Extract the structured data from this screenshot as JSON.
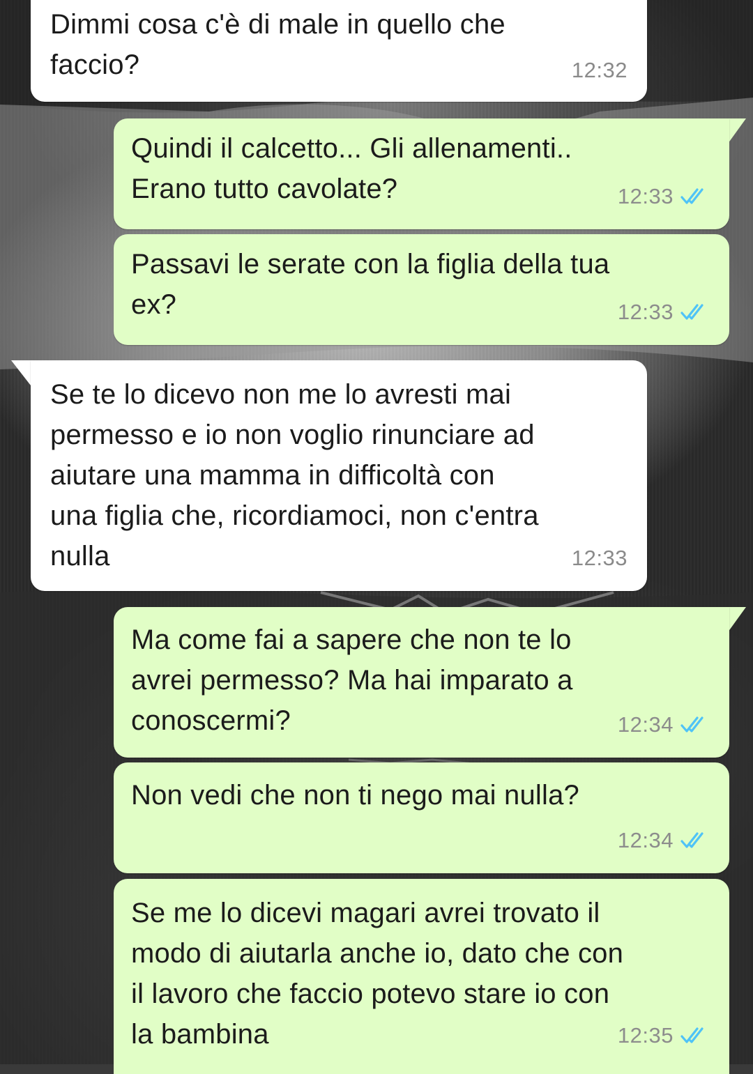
{
  "colors": {
    "incoming_bubble": "#ffffff",
    "outgoing_bubble": "#e1fec6",
    "timestamp": "#8c8c8c",
    "read_ticks": "#4fc3f7",
    "text": "#1b1b1b"
  },
  "messages": [
    {
      "direction": "incoming",
      "text": "Dimmi cosa c'è di male in quello che\nfaccio?",
      "time": "12:32"
    },
    {
      "direction": "outgoing",
      "text": "Quindi il calcetto... Gli allenamenti..\nErano tutto cavolate?",
      "time": "12:33",
      "status_icon": "double-check-read-icon"
    },
    {
      "direction": "outgoing",
      "text": "Passavi le serate con la figlia della tua\nex?",
      "time": "12:33",
      "status_icon": "double-check-read-icon"
    },
    {
      "direction": "incoming",
      "text": "Se te lo dicevo non me lo avresti mai\npermesso e io non voglio rinunciare ad\naiutare una mamma in difficoltà con\nuna figlia che, ricordiamoci, non c'entra\nnulla",
      "time": "12:33"
    },
    {
      "direction": "outgoing",
      "text": "Ma come fai a sapere che non te lo\navrei permesso? Ma hai imparato a\nconoscermi?",
      "time": "12:34",
      "status_icon": "double-check-read-icon"
    },
    {
      "direction": "outgoing",
      "text": "Non vedi che non ti nego mai nulla?",
      "time": "12:34",
      "status_icon": "double-check-read-icon"
    },
    {
      "direction": "outgoing",
      "text": "Se me lo dicevi magari avrei trovato il\nmodo di aiutarla anche io, dato che con\nil lavoro che faccio potevo stare io con\nla bambina",
      "time": "12:35",
      "status_icon": "double-check-read-icon"
    }
  ]
}
